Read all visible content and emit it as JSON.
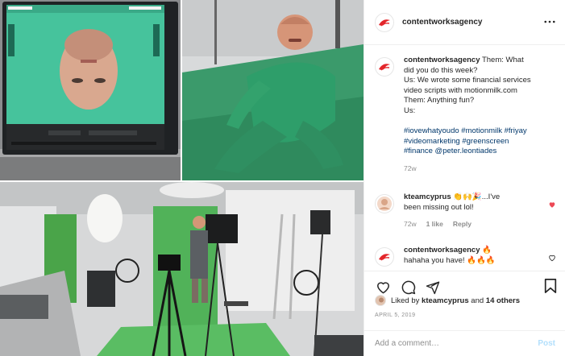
{
  "post": {
    "username": "contentworksagency",
    "colors": {
      "brand_red": "#e3262b",
      "link": "#00376b",
      "muted": "#8e8e8e",
      "like_red": "#ed4956",
      "post_button": "#b2dffc"
    }
  },
  "header": {
    "username": "contentworksagency",
    "more_icon": "more-horizontal-icon"
  },
  "caption": {
    "username": "contentworksagency",
    "lines": [
      "Them: What",
      "did you do this week?",
      "Us: We wrote some financial services",
      "video scripts with motionmilk.com",
      "Them: Anything fun?",
      "Us:"
    ],
    "hashtag_lines": [
      "#iovewhatyoudo #motionmilk #friyay",
      "#videomarketing #greenscreen",
      "#finance @peter.leontiades"
    ],
    "time": "72w"
  },
  "comments": [
    {
      "username": "kteamcyprus",
      "emoji": "👏🙌🎉",
      "text_after_emoji": "...I've",
      "text_line2": "been missing out lol!",
      "time": "72w",
      "likes": "1 like",
      "reply": "Reply",
      "liked": true
    },
    {
      "username": "contentworksagency",
      "emoji": "🔥",
      "text_line2": "hahaha you have!",
      "emoji2": "🔥🔥🔥"
    }
  ],
  "actions": {
    "like_icon": "heart-icon",
    "comment_icon": "comment-icon",
    "share_icon": "share-icon",
    "save_icon": "bookmark-icon"
  },
  "likes": {
    "prefix": "Liked by",
    "user": "kteamcyprus",
    "and": "and",
    "others": "14 others"
  },
  "date": "APRIL 5, 2019",
  "add_comment": {
    "placeholder": "Add a comment…",
    "post_label": "Post"
  }
}
